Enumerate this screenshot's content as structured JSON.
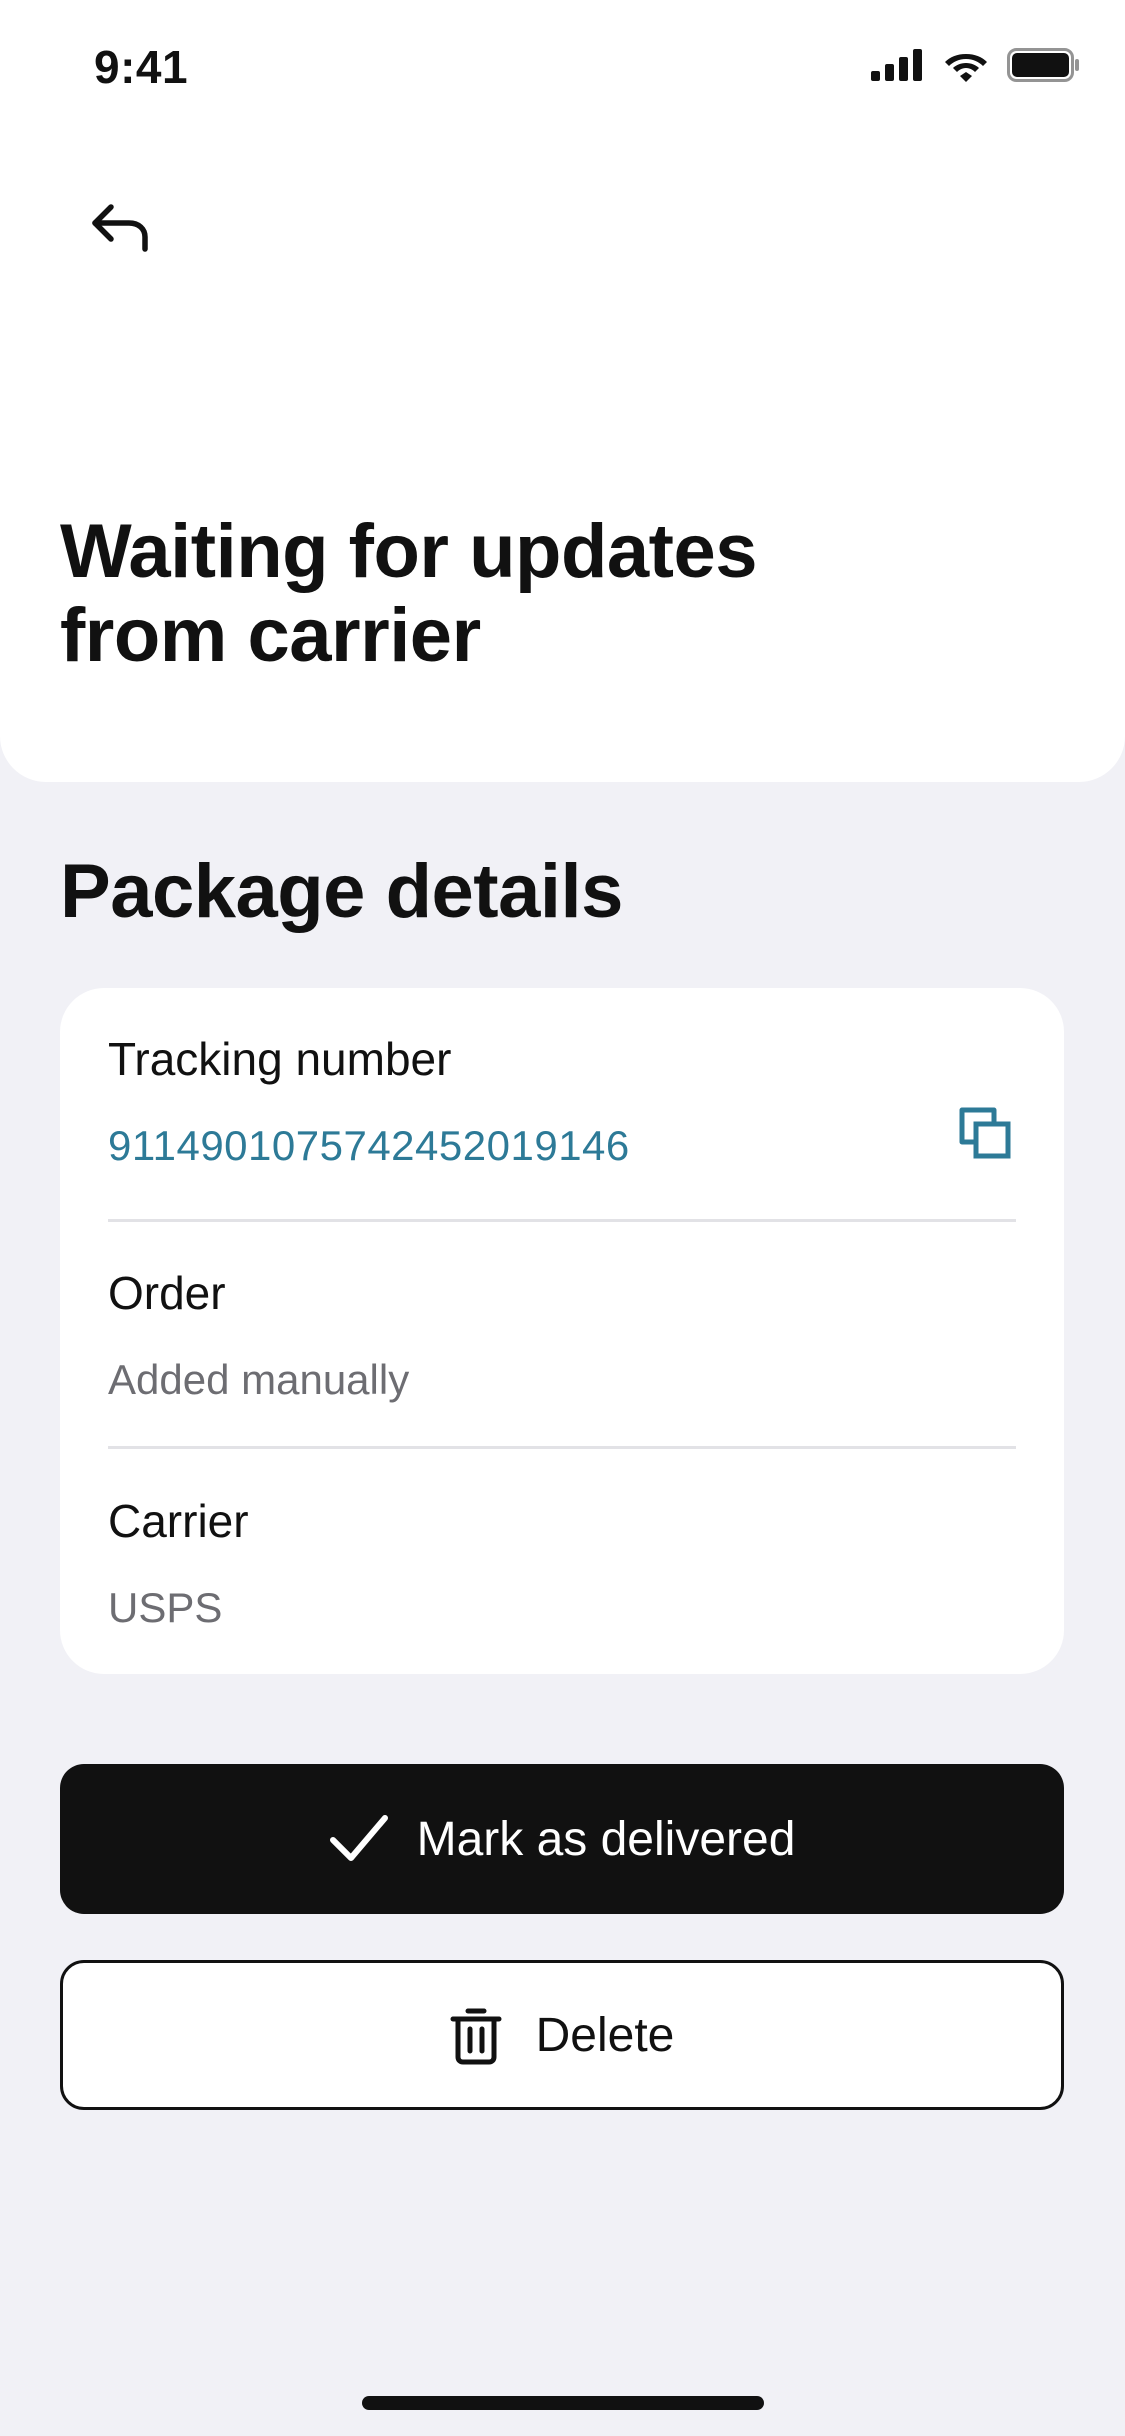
{
  "status_bar": {
    "time": "9:41"
  },
  "header": {
    "title_line1": "Waiting for updates",
    "title_line2": "from carrier"
  },
  "package_details": {
    "section_title": "Package details",
    "tracking": {
      "label": "Tracking number",
      "value": "9114901075742452019146"
    },
    "order": {
      "label": "Order",
      "value": "Added manually"
    },
    "carrier": {
      "label": "Carrier",
      "value": "USPS"
    }
  },
  "actions": {
    "mark_delivered": "Mark as delivered",
    "delete": "Delete"
  },
  "icons": {
    "back": "back-arrow-icon",
    "copy": "copy-icon",
    "check": "checkmark-icon",
    "trash": "trash-icon"
  },
  "colors": {
    "background": "#f1f1f6",
    "card": "#ffffff",
    "primary": "#111111",
    "link": "#2d7a97",
    "secondary_text": "#6d6d72"
  }
}
